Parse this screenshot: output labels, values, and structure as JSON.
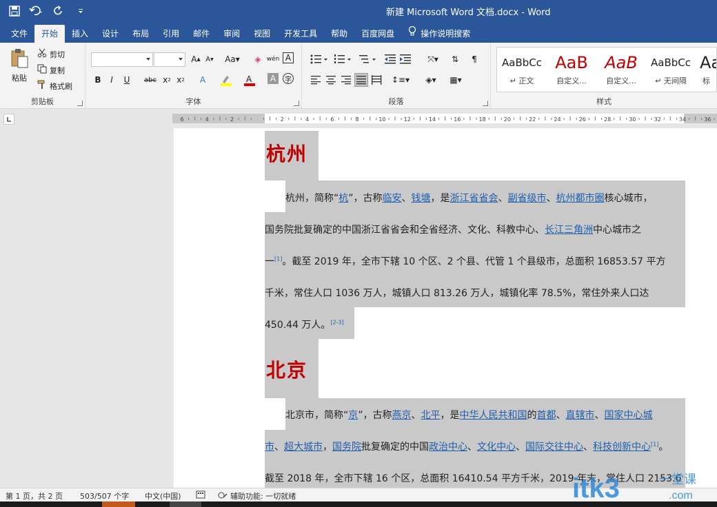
{
  "titlebar": {
    "title": "新建 Microsoft Word 文档.docx  -  Word"
  },
  "tabs": [
    {
      "label": "文件"
    },
    {
      "label": "开始"
    },
    {
      "label": "插入"
    },
    {
      "label": "设计"
    },
    {
      "label": "布局"
    },
    {
      "label": "引用"
    },
    {
      "label": "邮件"
    },
    {
      "label": "审阅"
    },
    {
      "label": "视图"
    },
    {
      "label": "开发工具"
    },
    {
      "label": "帮助"
    },
    {
      "label": "百度网盘"
    }
  ],
  "tell_me": "操作说明搜索",
  "ribbon": {
    "clipboard": {
      "label": "剪贴板",
      "paste": "粘贴",
      "cut": "剪切",
      "copy": "复制",
      "format_painter": "格式刷"
    },
    "font": {
      "label": "字体",
      "name_value": "",
      "size_value": ""
    },
    "paragraph": {
      "label": "段落"
    },
    "styles": {
      "label": "样式",
      "items": [
        {
          "preview": "AaBbCc",
          "name": "↵ 正文"
        },
        {
          "preview": "AaB",
          "name": "自定义..."
        },
        {
          "preview": "AaB",
          "name": "自定义..."
        },
        {
          "preview": "AaBbCc",
          "name": "↵ 无间隔"
        },
        {
          "preview": "Aa",
          "name": "标"
        }
      ]
    }
  },
  "ruler": {
    "labels": [
      "6",
      "4",
      "2",
      "",
      "2",
      "4",
      "6",
      "8",
      "10",
      "12",
      "14",
      "16",
      "18",
      "20",
      "22",
      "24",
      "26",
      "28",
      "30",
      "32",
      "34",
      "36"
    ]
  },
  "document": {
    "h1": "杭州",
    "p1": {
      "l1": [
        "杭州，简称“",
        "杭",
        "”，古称",
        "临安",
        "、",
        "钱塘",
        "，是",
        "浙江省省会",
        "、",
        "副省级市",
        "、",
        "杭州都市圈",
        "核心城市，"
      ],
      "l2": [
        "国务院批复确定的中国浙江省省会和全省经济、文化、科教中心、",
        "长江三角洲",
        "中心城市之"
      ],
      "l3": [
        "一",
        "[1]",
        "。截至 2019 年，全市下辖 10 个区、2 个县、代管 1 个县级市，总面积 16853.57 平方"
      ],
      "l4": "千米，常住人口 1036 万人，城镇人口 813.26 万人，城镇化率 78.5%，常住外来人口达",
      "l5": [
        "450.44 万人。",
        "[2-3]"
      ]
    },
    "h2": "北京",
    "p2": {
      "l1": [
        "北京市，简称“",
        "京",
        "”，古称",
        "燕京",
        "、",
        "北平",
        "，是",
        "中华人民共和国",
        "的",
        "首都",
        "、",
        "直辖市",
        "、",
        "国家中心城"
      ],
      "l2": [
        "市",
        "、",
        "超大城市",
        "，",
        "国务院",
        "批复确定的中国",
        "政治中心",
        "、",
        "文化中心",
        "、",
        "国际交往中心",
        "、",
        "科技创新中心",
        "[1]",
        "。"
      ],
      "l3": "截至 2018 年，全市下辖 16 个区，总面积 16410.54 平方千米，2019 年末，常住人口 2153.6"
    }
  },
  "statusbar": {
    "page": "第 1 页，共 2 页",
    "words": "503/507 个字",
    "lang": "中文(中国)",
    "accessibility": "辅助功能: 一切就绪"
  },
  "watermark": {
    "brand": "itk3",
    "sub": "一堂课",
    "domain": ".com"
  },
  "colors": {
    "accent": "#2b579a",
    "heading": "#c00000",
    "link": "#1f5fae",
    "selection": "#c9c9c9"
  }
}
